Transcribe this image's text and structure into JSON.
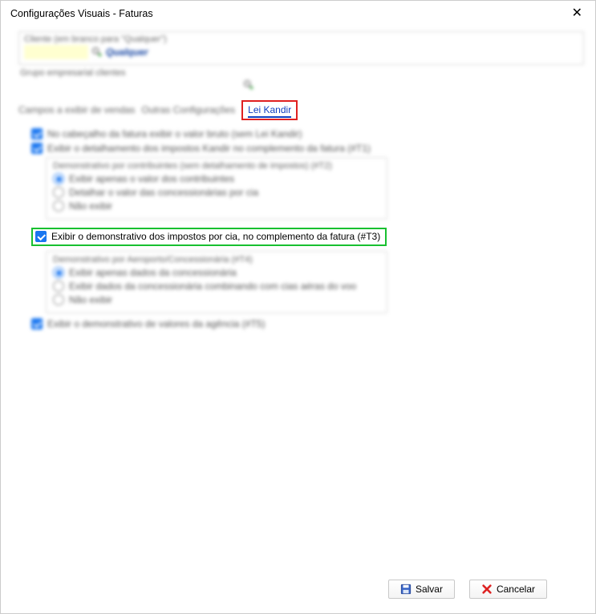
{
  "window": {
    "title": "Configurações Visuais - Faturas"
  },
  "client": {
    "label": "Cliente (em branco para \"Qualquer\")",
    "value": "",
    "placeholder_word": "Qualquer"
  },
  "grupo": {
    "label": "Grupo empresarial clientes"
  },
  "tabs": {
    "t1": "Campos a exibir de vendas",
    "t2": "Outras Configurações",
    "t3": "Lei Kandir"
  },
  "opts": {
    "chk_header": "No cabeçalho da fatura exibir o valor bruto (sem Lei Kandir)",
    "chk_detalhamento": "Exibir o detalhamento dos impostos Kandir no complemento da fatura (#T1)",
    "grp_t2_title": "Demonstrativo por contribuintes (sem detalhamento de impostos) (#T2)",
    "r_t2_a": "Exibir apenas o valor dos contribuintes",
    "r_t2_b": "Detalhar o valor das concessionárias por cia",
    "r_t2_c": "Não exibir",
    "chk_t3": "Exibir o demonstrativo dos impostos por cia, no complemento da fatura (#T3)",
    "grp_t4_title": "Demonstrativo por Aeroporto/Concessionária (#T4)",
    "r_t4_a": "Exibir apenas dados da concessionária",
    "r_t4_b": "Exibir dados da concessionária combinando com cias aéras do voo",
    "r_t4_c": "Não exibir",
    "chk_t5": "Exibir o demonstrativo de valores da agência (#T5)"
  },
  "buttons": {
    "save": "Salvar",
    "cancel": "Cancelar"
  }
}
